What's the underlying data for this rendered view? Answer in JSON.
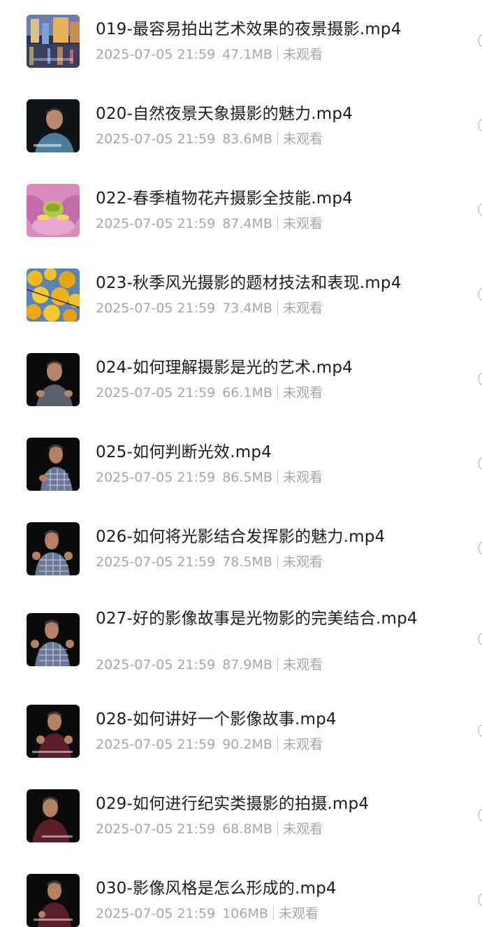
{
  "files": [
    {
      "name": "019-最容易拍出艺术效果的夜景摄影.mp4",
      "date": "2025-07-05 21:59",
      "size": "47.1MB",
      "status": "未观看",
      "thumbnail": "night-city-icon"
    },
    {
      "name": "020-自然夜景天象摄影的魅力.mp4",
      "date": "2025-07-05 21:59",
      "size": "83.6MB",
      "status": "未观看",
      "thumbnail": "presenter-icon"
    },
    {
      "name": "022-春季植物花卉摄影全技能.mp4",
      "date": "2025-07-05 21:59",
      "size": "87.4MB",
      "status": "未观看",
      "thumbnail": "lotus-flower-icon"
    },
    {
      "name": "023-秋季风光摄影的题材技法和表现.mp4",
      "date": "2025-07-05 21:59",
      "size": "73.4MB",
      "status": "未观看",
      "thumbnail": "autumn-leaves-icon"
    },
    {
      "name": "024-如何理解摄影是光的艺术.mp4",
      "date": "2025-07-05 21:59",
      "size": "66.1MB",
      "status": "未观看",
      "thumbnail": "presenter-icon"
    },
    {
      "name": "025-如何判断光效.mp4",
      "date": "2025-07-05 21:59",
      "size": "86.5MB",
      "status": "未观看",
      "thumbnail": "presenter-icon"
    },
    {
      "name": "026-如何将光影结合发挥影的魅力.mp4",
      "date": "2025-07-05 21:59",
      "size": "78.5MB",
      "status": "未观看",
      "thumbnail": "presenter-icon"
    },
    {
      "name": "027-好的影像故事是光物影的完美结合.mp4",
      "date": "2025-07-05 21:59",
      "size": "87.9MB",
      "status": "未观看",
      "thumbnail": "presenter-icon"
    },
    {
      "name": "028-如何讲好一个影像故事.mp4",
      "date": "2025-07-05 21:59",
      "size": "90.2MB",
      "status": "未观看",
      "thumbnail": "presenter-icon"
    },
    {
      "name": "029-如何进行纪实类摄影的拍摄.mp4",
      "date": "2025-07-05 21:59",
      "size": "68.8MB",
      "status": "未观看",
      "thumbnail": "presenter-icon"
    },
    {
      "name": "030-影像风格是怎么形成的.mp4",
      "date": "2025-07-05 21:59",
      "size": "106MB",
      "status": "未观看",
      "thumbnail": "presenter-icon"
    }
  ],
  "colors": {
    "title": "#1c1c1c",
    "meta": "#a6a6a6",
    "separator": "#c8c8c8"
  }
}
